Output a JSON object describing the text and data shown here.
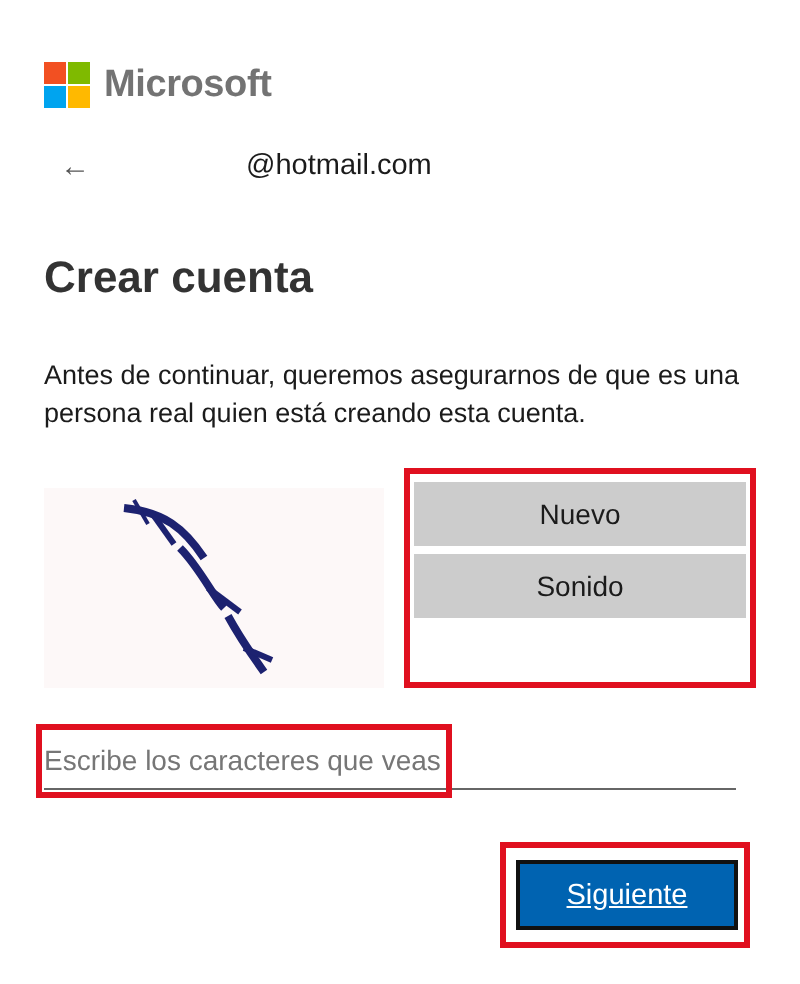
{
  "brand": {
    "name": "Microsoft"
  },
  "account": {
    "back": "←",
    "email": "@hotmail.com"
  },
  "title": "Crear cuenta",
  "description": "Antes de continuar, queremos asegurarnos de que es una persona real quien está creando esta cuenta.",
  "captcha": {
    "kind": "picture",
    "buttons": [
      "Nuevo",
      "Sonido"
    ]
  },
  "field": {
    "placeholder": "Escribe los caracteres que veas"
  },
  "submit": {
    "label": "Siguiente"
  }
}
